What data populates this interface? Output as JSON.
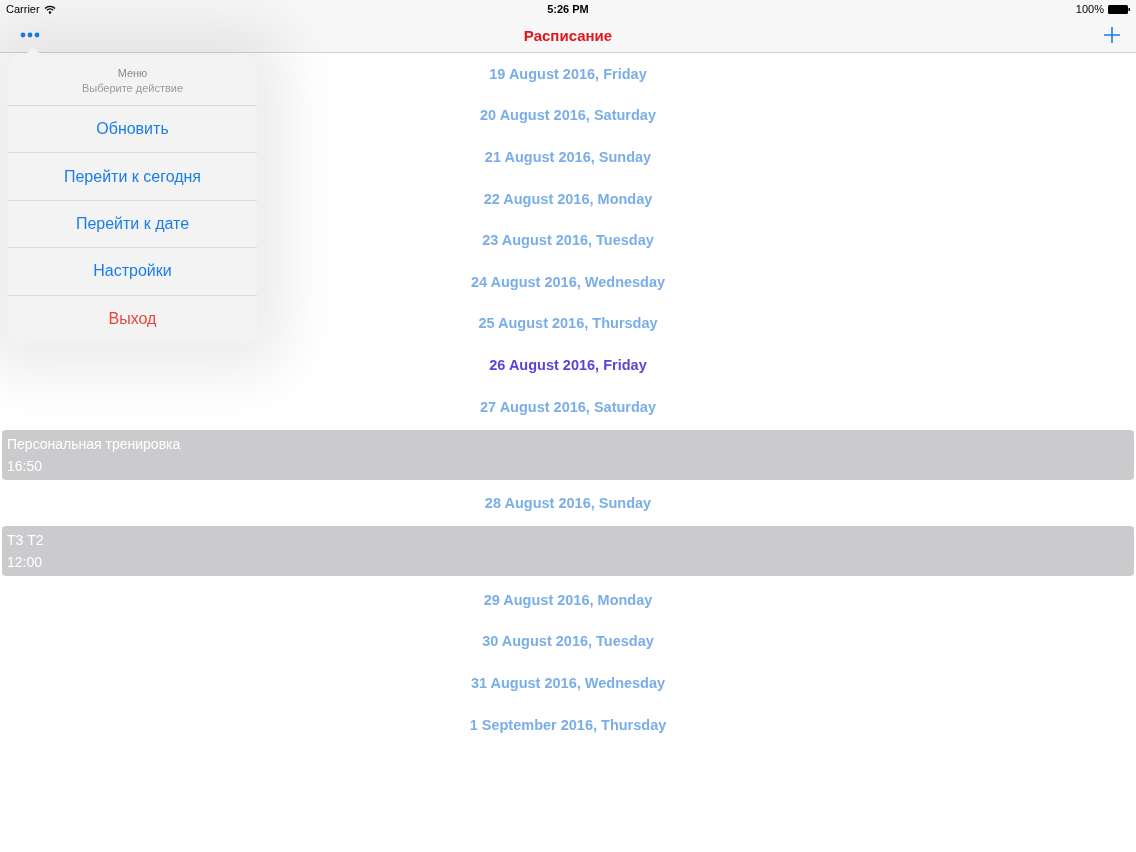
{
  "status_bar": {
    "carrier": "Carrier",
    "time": "5:26 PM",
    "battery": "100%"
  },
  "nav_bar": {
    "title": "Расписание"
  },
  "menu": {
    "title": "Меню",
    "subtitle": "Выберите действие",
    "items": [
      {
        "label": "Обновить",
        "kind": "action"
      },
      {
        "label": "Перейти к сегодня",
        "kind": "action"
      },
      {
        "label": "Перейти к дате",
        "kind": "action"
      },
      {
        "label": "Настройки",
        "kind": "action"
      },
      {
        "label": "Выход",
        "kind": "destructive"
      }
    ]
  },
  "schedule": [
    {
      "kind": "day",
      "label": "19 August 2016, Friday",
      "selected": false
    },
    {
      "kind": "day",
      "label": "20 August 2016, Saturday",
      "selected": false
    },
    {
      "kind": "day",
      "label": "21 August 2016, Sunday",
      "selected": false
    },
    {
      "kind": "day",
      "label": "22 August 2016, Monday",
      "selected": false
    },
    {
      "kind": "day",
      "label": "23 August 2016, Tuesday",
      "selected": false
    },
    {
      "kind": "day",
      "label": "24 August 2016, Wednesday",
      "selected": false
    },
    {
      "kind": "day",
      "label": "25 August 2016, Thursday",
      "selected": false
    },
    {
      "kind": "day",
      "label": "26 August 2016, Friday",
      "selected": true
    },
    {
      "kind": "day",
      "label": "27 August 2016, Saturday",
      "selected": false
    },
    {
      "kind": "event",
      "title": "Персональная тренировка",
      "time": "16:50"
    },
    {
      "kind": "day",
      "label": "28 August 2016, Sunday",
      "selected": false
    },
    {
      "kind": "event",
      "title": "Т3 Т2",
      "time": "12:00"
    },
    {
      "kind": "day",
      "label": "29 August 2016, Monday",
      "selected": false
    },
    {
      "kind": "day",
      "label": "30 August 2016, Tuesday",
      "selected": false
    },
    {
      "kind": "day",
      "label": "31 August 2016, Wednesday",
      "selected": false
    },
    {
      "kind": "day",
      "label": "1 September 2016, Thursday",
      "selected": false
    }
  ]
}
